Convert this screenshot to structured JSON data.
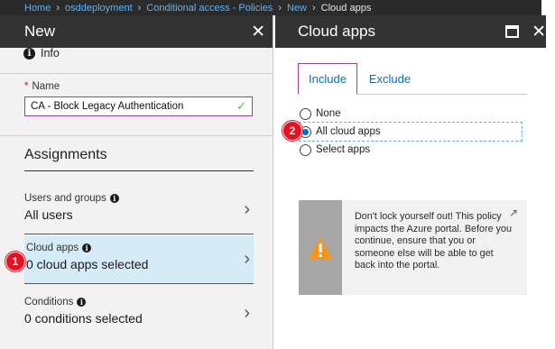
{
  "breadcrumb": {
    "items": [
      "Home",
      "osddeployment",
      "Conditional access - Policies",
      "New",
      "Cloud apps"
    ]
  },
  "left_blade": {
    "title": "New",
    "info_label": "Info",
    "name_label": "Name",
    "name_value": "CA - Block Legacy Authentication",
    "assignments_title": "Assignments",
    "items": [
      {
        "label": "Users and groups",
        "value": "All users"
      },
      {
        "label": "Cloud apps",
        "value": "0 cloud apps selected"
      },
      {
        "label": "Conditions",
        "value": "0 conditions selected"
      }
    ]
  },
  "right_blade": {
    "title": "Cloud apps",
    "tabs": [
      "Include",
      "Exclude"
    ],
    "options": [
      "None",
      "All cloud apps",
      "Select apps"
    ],
    "selected_option": "All cloud apps",
    "warning": "Don't lock yourself out! This policy impacts the Azure portal. Before you continue, ensure that you or someone else will be able to get back into the portal."
  },
  "callouts": [
    "1",
    "2"
  ],
  "colors": {
    "accent_blue": "#0072c6",
    "selected_row": "#d6ebf8",
    "header_dark": "#333333",
    "callout_red": "#e81123",
    "warning_orange": "#f7941d"
  }
}
